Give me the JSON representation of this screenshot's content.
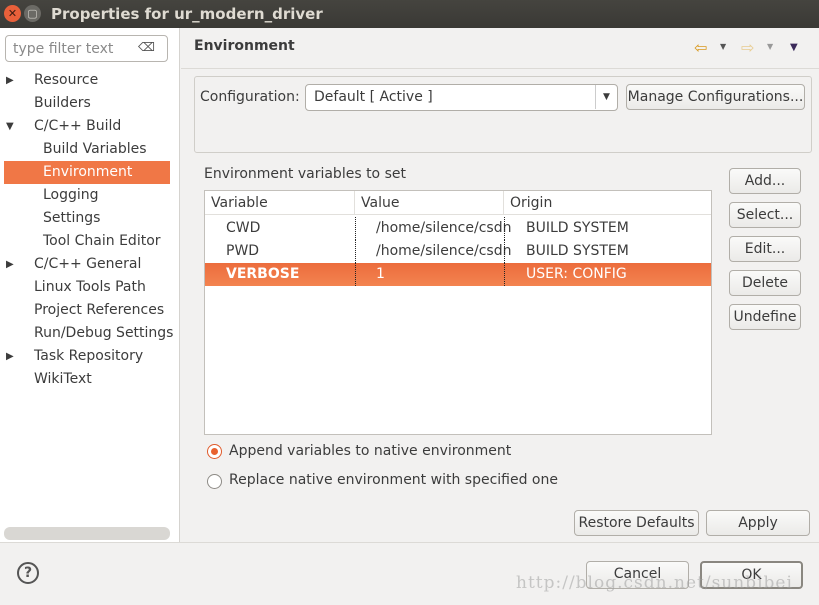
{
  "window": {
    "title": "Properties for ur_modern_driver"
  },
  "sidebar": {
    "filter_placeholder": "type filter text",
    "items": [
      {
        "label": "Resource",
        "expander": "collapsed",
        "indent": 0
      },
      {
        "label": "Builders",
        "expander": "none",
        "indent": 0
      },
      {
        "label": "C/C++ Build",
        "expander": "expanded",
        "indent": 0
      },
      {
        "label": "Build Variables",
        "expander": "none",
        "indent": 1
      },
      {
        "label": "Environment",
        "expander": "none",
        "indent": 1,
        "selected": true
      },
      {
        "label": "Logging",
        "expander": "none",
        "indent": 1
      },
      {
        "label": "Settings",
        "expander": "none",
        "indent": 1
      },
      {
        "label": "Tool Chain Editor",
        "expander": "none",
        "indent": 1
      },
      {
        "label": "C/C++ General",
        "expander": "collapsed",
        "indent": 0
      },
      {
        "label": "Linux Tools Path",
        "expander": "none",
        "indent": 0
      },
      {
        "label": "Project References",
        "expander": "none",
        "indent": 0
      },
      {
        "label": "Run/Debug Settings",
        "expander": "none",
        "indent": 0
      },
      {
        "label": "Task Repository",
        "expander": "collapsed",
        "indent": 0
      },
      {
        "label": "WikiText",
        "expander": "none",
        "indent": 0
      }
    ]
  },
  "main": {
    "title": "Environment",
    "config_label": "Configuration:",
    "config_value": "Default  [ Active ]",
    "manage_label": "Manage Configurations...",
    "env_label": "Environment variables to set",
    "columns": [
      "Variable",
      "Value",
      "Origin"
    ],
    "rows": [
      {
        "variable": "CWD",
        "value": "/home/silence/csdn",
        "origin": "BUILD SYSTEM"
      },
      {
        "variable": "PWD",
        "value": "/home/silence/csdn",
        "origin": "BUILD SYSTEM"
      },
      {
        "variable": "VERBOSE",
        "value": "1",
        "origin": "USER: CONFIG",
        "selected": true
      }
    ],
    "side_buttons": [
      "Add...",
      "Select...",
      "Edit...",
      "Delete",
      "Undefine"
    ],
    "radio_append": "Append variables to native environment",
    "radio_replace": "Replace native environment with specified one",
    "radio_selected": "append",
    "restore_label": "Restore Defaults",
    "apply_label": "Apply"
  },
  "footer": {
    "cancel_label": "Cancel",
    "ok_label": "OK",
    "help_icon": "?"
  },
  "watermark": "http://blog.csdn.net/sunbibei",
  "colors": {
    "accent": "#f07746",
    "titlebar": "#3c3b37"
  }
}
